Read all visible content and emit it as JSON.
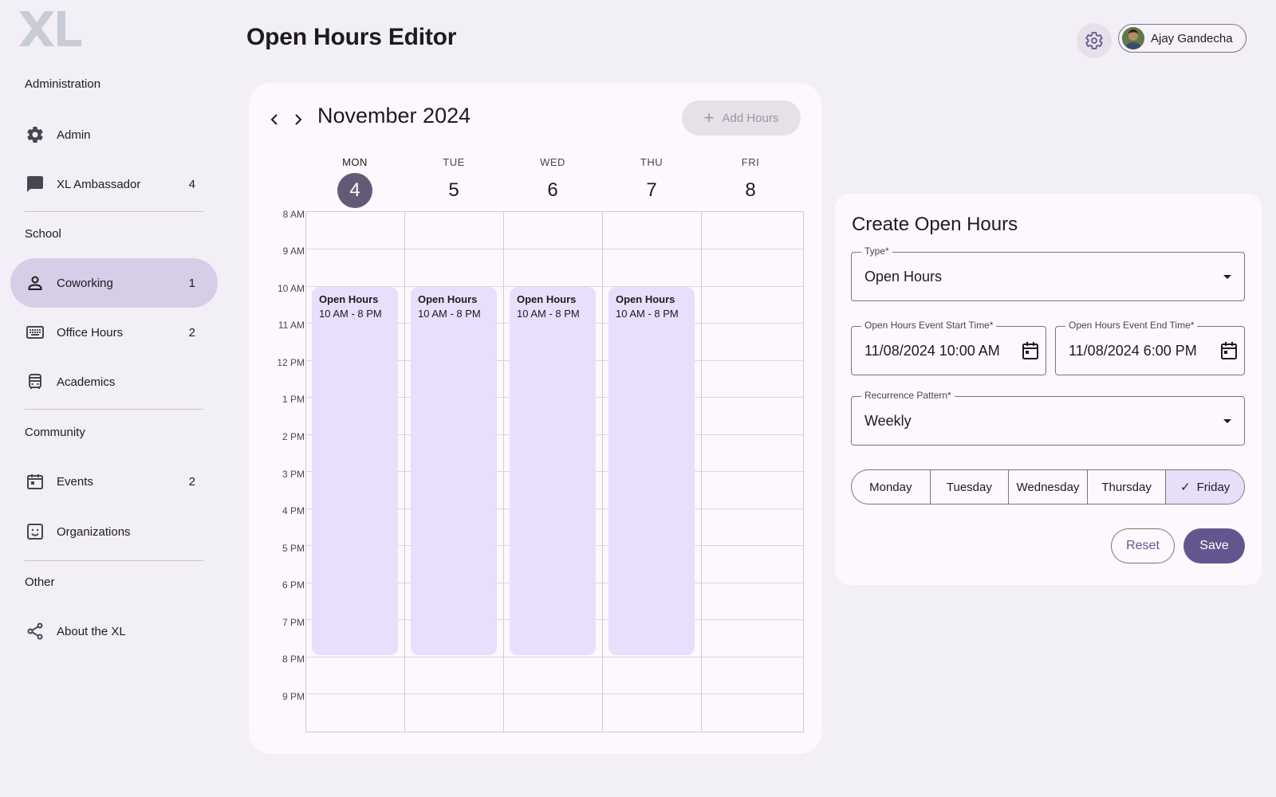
{
  "brand": {
    "logo_text": "XL"
  },
  "header": {
    "title": "Open Hours Editor",
    "user_name": "Ajay Gandecha"
  },
  "sidebar": {
    "sections": {
      "administration": "Administration",
      "school": "School",
      "community": "Community",
      "other": "Other"
    },
    "items": {
      "admin": {
        "label": "Admin",
        "count": ""
      },
      "ambassador": {
        "label": "XL Ambassador",
        "count": "4"
      },
      "coworking": {
        "label": "Coworking",
        "count": "1"
      },
      "office_hours": {
        "label": "Office Hours",
        "count": "2"
      },
      "academics": {
        "label": "Academics",
        "count": ""
      },
      "events": {
        "label": "Events",
        "count": "2"
      },
      "organizations": {
        "label": "Organizations",
        "count": ""
      },
      "about": {
        "label": "About the XL",
        "count": ""
      }
    }
  },
  "calendar": {
    "month": "November 2024",
    "add_hours_label": "Add Hours",
    "days": [
      {
        "name": "MON",
        "num": "4"
      },
      {
        "name": "TUE",
        "num": "5"
      },
      {
        "name": "WED",
        "num": "6"
      },
      {
        "name": "THU",
        "num": "7"
      },
      {
        "name": "FRI",
        "num": "8"
      }
    ],
    "times": [
      "8 AM",
      "9 AM",
      "10 AM",
      "11 AM",
      "12 PM",
      "1 PM",
      "2 PM",
      "3 PM",
      "4 PM",
      "5 PM",
      "6 PM",
      "7 PM",
      "8 PM",
      "9 PM"
    ],
    "events": [
      {
        "title": "Open Hours",
        "time": "10 AM - 8 PM"
      },
      {
        "title": "Open Hours",
        "time": "10 AM - 8 PM"
      },
      {
        "title": "Open Hours",
        "time": "10 AM - 8 PM"
      },
      {
        "title": "Open Hours",
        "time": "10 AM - 8 PM"
      }
    ]
  },
  "form": {
    "title": "Create Open Hours",
    "type": {
      "label": "Type*",
      "value": "Open Hours"
    },
    "start": {
      "label": "Open Hours Event Start Time*",
      "value": "11/08/2024  10:00 AM"
    },
    "end": {
      "label": "Open Hours Event End Time*",
      "value": "11/08/2024  6:00 PM"
    },
    "recurrence": {
      "label": "Recurrence Pattern*",
      "value": "Weekly"
    },
    "weekdays": [
      "Monday",
      "Tuesday",
      "Wednesday",
      "Thursday",
      "Friday"
    ],
    "selected_weekday": "Friday",
    "reset_label": "Reset",
    "save_label": "Save"
  },
  "colors": {
    "accent": "#65558f",
    "active_nav": "#d6cde6",
    "event_fill": "#e8dffc",
    "today": "#635a78",
    "background": "#f3eff6"
  }
}
